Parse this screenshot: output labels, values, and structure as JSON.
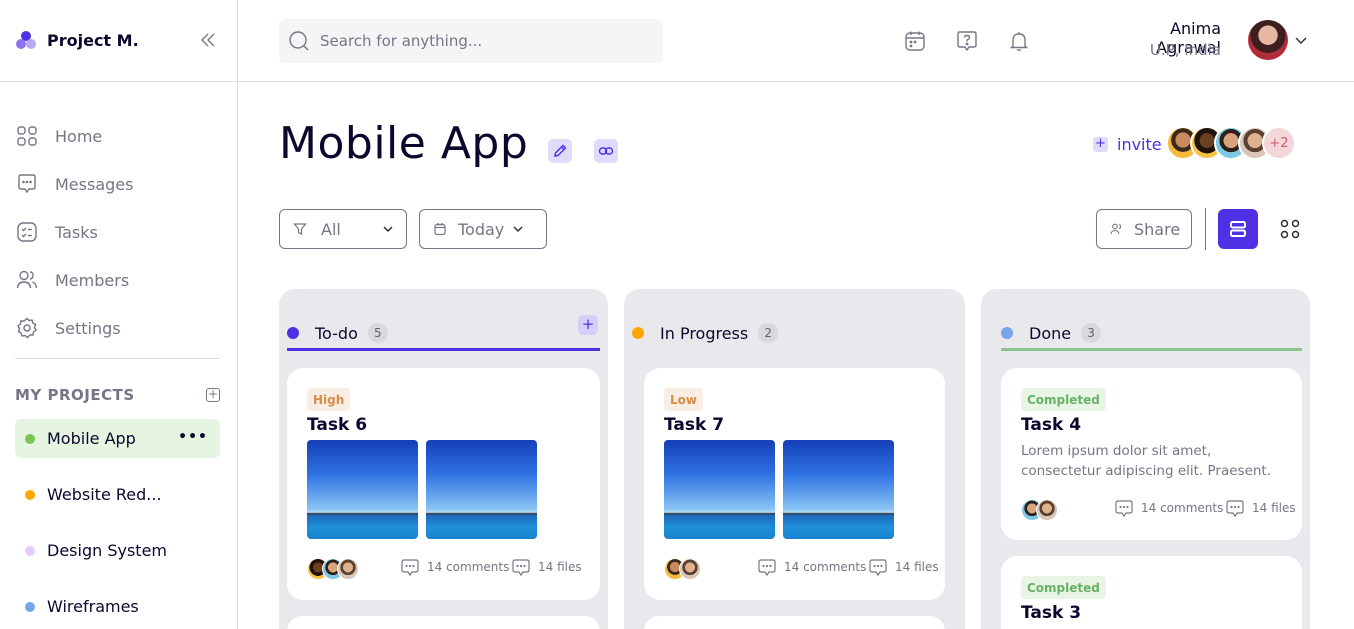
{
  "brand": {
    "name": "Project M."
  },
  "nav": [
    {
      "label": "Home",
      "icon": "home-icon"
    },
    {
      "label": "Messages",
      "icon": "messages-icon"
    },
    {
      "label": "Tasks",
      "icon": "tasks-icon"
    },
    {
      "label": "Members",
      "icon": "members-icon"
    },
    {
      "label": "Settings",
      "icon": "settings-icon"
    }
  ],
  "projects": {
    "heading": "MY PROJECTS",
    "items": [
      {
        "label": "Mobile App",
        "color": "#7ac555",
        "active": true
      },
      {
        "label": "Website Red...",
        "color": "#ffa500"
      },
      {
        "label": "Design System",
        "color": "#e4ccfd"
      },
      {
        "label": "Wireframes",
        "color": "#76a5ea"
      }
    ]
  },
  "search": {
    "placeholder": "Search for anything..."
  },
  "user": {
    "name": "Anima Agrawal",
    "location": "U.P, India"
  },
  "page": {
    "title": "Mobile App",
    "invite_label": "invite",
    "team_more": "+2"
  },
  "toolbar": {
    "filter_label": "All",
    "date_label": "Today",
    "share_label": "Share"
  },
  "columns": [
    {
      "name": "To-do",
      "count": "5",
      "color": "#5030e5",
      "cards": [
        {
          "badge": "High",
          "badge_bg": "#f9eee3",
          "badge_fg": "#d58d49",
          "title": "Task 6",
          "comments": "14 comments",
          "files": "14 files"
        }
      ]
    },
    {
      "name": "In Progress",
      "count": "2",
      "color": "#ffa500",
      "cards": [
        {
          "badge": "Low",
          "badge_bg": "#f9eee3",
          "badge_fg": "#d58d49",
          "title": "Task 7",
          "comments": "14 comments",
          "files": "14 files"
        }
      ]
    },
    {
      "name": "Done",
      "count": "3",
      "color": "#76a5ea",
      "line_color": "#8bc48a",
      "cards": [
        {
          "badge": "Completed",
          "badge_bg": "#e8f5e4",
          "badge_fg": "#68b266",
          "title": "Task 4",
          "desc": "Lorem ipsum dolor sit amet, consectetur adipiscing elit. Praesent.",
          "comments": "14 comments",
          "files": "14 files"
        },
        {
          "badge": "Completed",
          "badge_bg": "#e8f5e4",
          "badge_fg": "#68b266",
          "title": "Task 3"
        }
      ]
    }
  ]
}
